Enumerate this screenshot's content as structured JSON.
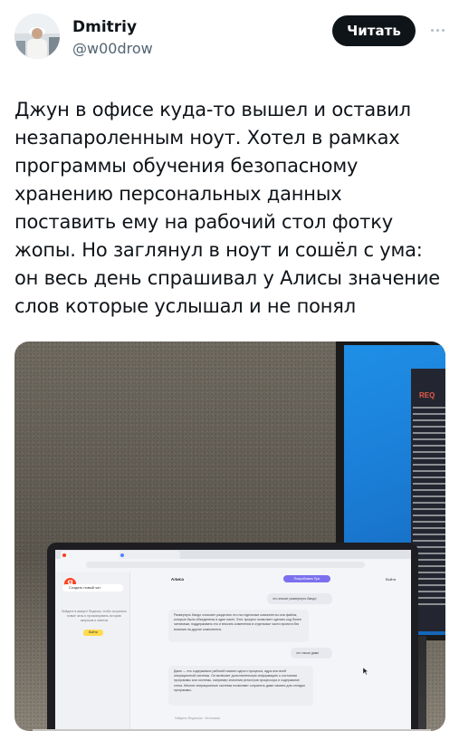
{
  "author": {
    "display_name": "Dmitriy",
    "handle": "@w00drow",
    "avatar": "avatar-photo"
  },
  "actions": {
    "follow_label": "Читать",
    "more_icon": "more-horizontal-icon"
  },
  "tweet": {
    "text": "Джун в офисе куда-то вышел и оставил незапароленным ноут. Хотел в рамках программы обучения безопасному хранению персональных данных поставить ему на рабочий стол фотку жопы. Но заглянул в ноут и сошёл с ума: он весь день спрашивал у Алисы значение слов которые услышал и не понял"
  },
  "photo": {
    "monitor": {
      "header": "REQ",
      "accent_color": "#1b7fd8"
    },
    "laptop": {
      "chat_title": "Алиса",
      "sidebar_new_chat": "Создать новый чат",
      "sidebar_note": "Войдите в аккаунт Яндекса, чтобы сохранять новые чаты и просматривать историю запросов и ответов",
      "sidebar_login": "Войти",
      "upgrade": "Попробовать Про",
      "login_link": "Войти",
      "messages": [
        {
          "role": "user",
          "text": "что значит развернуть бандл"
        },
        {
          "role": "bot",
          "text": "Развернуть бандл означает разделить его на отдельные компоненты или файлы, которые были объединены в один пакет. Этот процесс позволяет сделать код более читаемым, поддерживать его и вносить изменения в отдельные части проекта без влияния на другие компоненты."
        },
        {
          "role": "user",
          "text": "что такое дамп"
        },
        {
          "role": "bot",
          "text": "Дамп — это содержимое рабочей памяти одного процесса, ядра или всей операционной системы. Он включает дополнительную информацию о состоянии программы или системы, например значения регистров процессора и содержимое стека. Многие операционные системы позволяют сохранять дамп памяти для отладки программы."
        }
      ],
      "message_actions": "Найдено Яндексом · Источники"
    }
  }
}
